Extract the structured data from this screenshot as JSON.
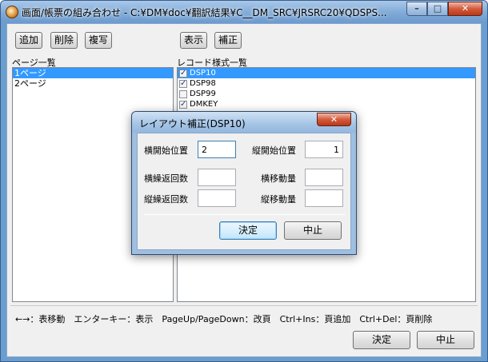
{
  "window": {
    "title": "画面/帳票の組み合わせ - C:¥DM¥doc¥翻訳結果¥C__DM_SRC¥JRSRC20¥QDSPS...",
    "icon": "app-icon",
    "caption_buttons": {
      "minimize": "–",
      "maximize": "□",
      "close": "✕"
    }
  },
  "toolbar_left": {
    "add_label": "追加",
    "delete_label": "削除",
    "copy_label": "複写"
  },
  "toolbar_right": {
    "display_label": "表示",
    "correct_label": "補正"
  },
  "page_list": {
    "label": "ページ一覧",
    "items": [
      {
        "label": "1ページ",
        "selected": true
      },
      {
        "label": "2ページ",
        "selected": false
      }
    ]
  },
  "record_list": {
    "label": "レコード様式一覧",
    "items": [
      {
        "label": "DSP10",
        "checked": true,
        "selected": true
      },
      {
        "label": "DSP98",
        "checked": true,
        "selected": false
      },
      {
        "label": "DSP99",
        "checked": false,
        "selected": false
      },
      {
        "label": "DMKEY",
        "checked": true,
        "selected": false
      }
    ]
  },
  "status_hint": "←→：表移動　エンターキー：表示　PageUp/PageDown：改頁　Ctrl+Ins：頁追加　Ctrl+Del：頁削除",
  "footer": {
    "ok_label": "決定",
    "cancel_label": "中止"
  },
  "dialog": {
    "title": "レイアウト補正(DSP10)",
    "close_glyph": "✕",
    "fields": {
      "h_start_label": "横開始位置",
      "h_start_value": "2",
      "v_start_label": "縦開始位置",
      "v_start_value": "1",
      "h_repeat_label": "横繰返回数",
      "h_repeat_value": "",
      "h_move_label": "横移動量",
      "h_move_value": "",
      "v_repeat_label": "縦繰返回数",
      "v_repeat_value": "",
      "v_move_label": "縦移動量",
      "v_move_value": ""
    },
    "ok_label": "決定",
    "cancel_label": "中止"
  }
}
